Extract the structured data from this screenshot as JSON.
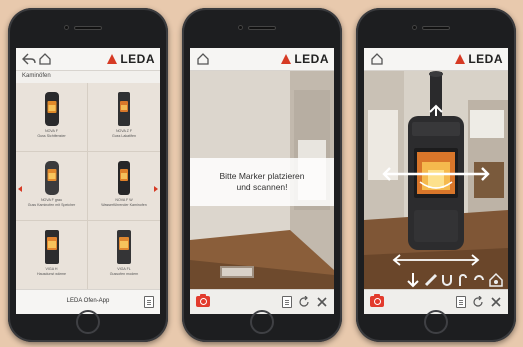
{
  "brand": {
    "logo_text": "LEDA",
    "logo_color": "#d63a24"
  },
  "background": "#e8c9ad",
  "screen1": {
    "section_title": "Kaminöfen",
    "products": [
      {
        "model": "NOVA F",
        "desc": "Guss Sichtfenster"
      },
      {
        "model": "NOVA Z F",
        "desc": "Guss Lakatifen"
      },
      {
        "model": "NOVA F grau",
        "desc": "Guss Kaminofen mit Speicher"
      },
      {
        "model": "NOVA F W",
        "desc": "Wasserführender Kaminofen"
      },
      {
        "model": "VIGA H",
        "desc": "Hausdunst wärme"
      },
      {
        "model": "VIGA FL",
        "desc": "Gussofen modern"
      }
    ],
    "app_name": "LEDA Ofen-App",
    "icons": [
      "back-icon",
      "home-icon",
      "document-icon"
    ]
  },
  "screen2": {
    "overlay_line1": "Bitte Marker platzieren",
    "overlay_line2": "und scannen!",
    "icons": [
      "home-icon",
      "camera-icon",
      "document-icon",
      "rotate-icon",
      "tools-icon"
    ]
  },
  "screen3": {
    "icons": [
      "home-icon",
      "camera-icon",
      "arrow-down-icon",
      "pipe-icon",
      "magnet-icon",
      "hook-icon",
      "loop-icon",
      "house-icon",
      "document-icon",
      "rotate-icon",
      "tools-icon"
    ],
    "accent": "#e23b2d"
  }
}
